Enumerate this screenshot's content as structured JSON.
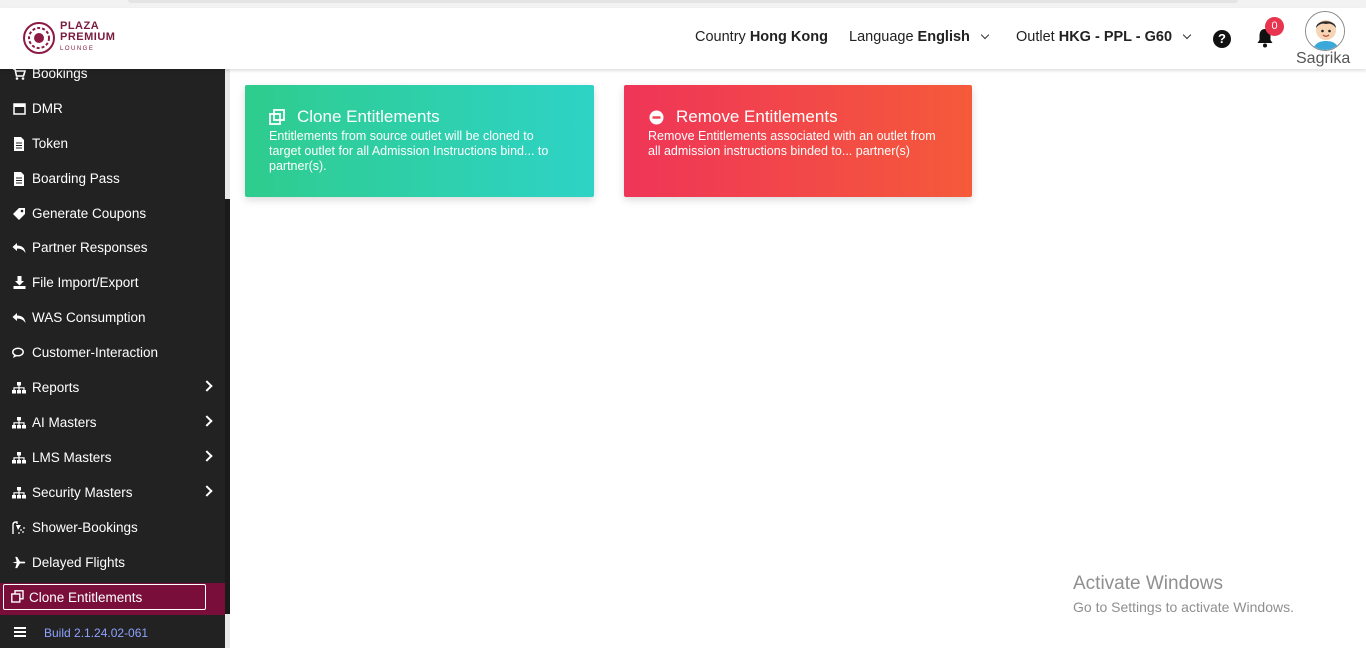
{
  "brand": {
    "line1": "PLAZA",
    "line2": "PREMIUM",
    "line3": "LOUNGE",
    "color": "#7a1a3e"
  },
  "header": {
    "country_label": "Country",
    "country_value": "Hong Kong",
    "language_label": "Language",
    "language_value": "English",
    "outlet_label": "Outlet",
    "outlet_value": "HKG - PPL - G60",
    "notification_count": "0",
    "username": "Sagrika"
  },
  "sidebar": {
    "items": [
      {
        "label": "Bookings",
        "icon": "cart-icon"
      },
      {
        "label": "DMR",
        "icon": "calendar-icon"
      },
      {
        "label": "Token",
        "icon": "file-icon"
      },
      {
        "label": "Boarding Pass",
        "icon": "file-icon"
      },
      {
        "label": "Generate Coupons",
        "icon": "ticket-icon"
      },
      {
        "label": "Partner Responses",
        "icon": "reply-icon"
      },
      {
        "label": "File Import/Export",
        "icon": "download-icon"
      },
      {
        "label": "WAS Consumption",
        "icon": "reply-icon"
      },
      {
        "label": "Customer-Interaction",
        "icon": "comments-icon"
      },
      {
        "label": "Reports",
        "icon": "sitemap-icon"
      },
      {
        "label": "AI Masters",
        "icon": "sitemap-icon"
      },
      {
        "label": "LMS Masters",
        "icon": "sitemap-icon"
      },
      {
        "label": "Security Masters",
        "icon": "sitemap-icon"
      },
      {
        "label": "Shower-Bookings",
        "icon": "shower-icon"
      },
      {
        "label": "Delayed Flights",
        "icon": "plane-icon"
      }
    ],
    "active_item": "Clone Entitlements",
    "build": "Build 2.1.24.02-061"
  },
  "cards": {
    "clone": {
      "title": "Clone Entitlements",
      "description": "Entitlements from source outlet will be cloned to target outlet for all Admission Instructions bind... to partner(s).",
      "color": "#2fcc8e"
    },
    "remove": {
      "title": "Remove Entitlements",
      "description": "Remove Entitlements associated with an outlet from all admission instructions binded to... partner(s)",
      "color": "#ef3558"
    }
  },
  "watermark": {
    "line1": "Activate Windows",
    "line2": "Go to Settings to activate Windows."
  }
}
